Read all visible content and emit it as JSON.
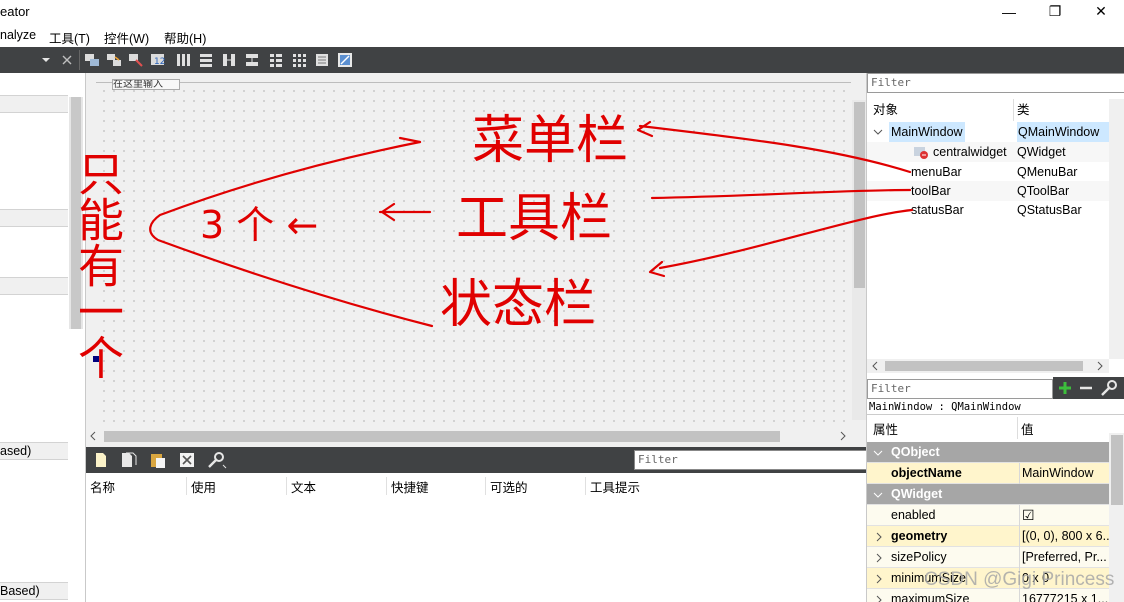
{
  "window": {
    "title_fragment": "eator",
    "controls": {
      "minimize": "—",
      "maximize": "❐",
      "close": "✕"
    }
  },
  "menubar": {
    "items": [
      "nalyze",
      "工具(T)",
      "控件(W)",
      "帮助(H)"
    ]
  },
  "left_dock": {
    "bottom_labels": [
      "ased)",
      "Based)"
    ]
  },
  "form_editor": {
    "tab_label": "在这里输入"
  },
  "action_editor": {
    "filter_placeholder": "Filter",
    "columns": [
      "名称",
      "使用",
      "文本",
      "快捷键",
      "可选的",
      "工具提示"
    ]
  },
  "object_inspector": {
    "filter_placeholder": "Filter",
    "headers": {
      "object": "对象",
      "class": "类"
    },
    "rows": [
      {
        "name": "MainWindow",
        "class": "QMainWindow"
      },
      {
        "name": "centralwidget",
        "class": "QWidget"
      },
      {
        "name": "menuBar",
        "class": "QMenuBar"
      },
      {
        "name": "toolBar",
        "class": "QToolBar"
      },
      {
        "name": "statusBar",
        "class": "QStatusBar"
      }
    ]
  },
  "property_editor": {
    "filter_placeholder": "Filter",
    "class_label": "MainWindow : QMainWindow",
    "headers": {
      "property": "属性",
      "value": "值"
    },
    "rows": [
      {
        "kind": "group",
        "name": "QObject",
        "value": ""
      },
      {
        "kind": "prop",
        "name": "objectName",
        "value": "MainWindow",
        "bold": true
      },
      {
        "kind": "group",
        "name": "QWidget",
        "value": ""
      },
      {
        "kind": "prop",
        "name": "enabled",
        "value": "☑",
        "bold": false
      },
      {
        "kind": "prop",
        "name": "geometry",
        "value": "[(0, 0), 800 x 6...",
        "bold": true
      },
      {
        "kind": "prop",
        "name": "sizePolicy",
        "value": "[Preferred, Pr...",
        "bold": false
      },
      {
        "kind": "prop",
        "name": "minimumSize",
        "value": "0 x 0",
        "bold": false
      },
      {
        "kind": "prop",
        "name": "maximumSize",
        "value": "16777215 x 1...",
        "bold": false
      }
    ]
  },
  "annotations": {
    "menubar_note": "菜单栏",
    "toolbar_note": "工具栏",
    "statusbar_note": "状态栏",
    "count_note": "3 个 ←",
    "side_note": "只能有一个"
  },
  "watermark": "CSDN @Gigi Princess",
  "colors": {
    "toolbar_bg": "#404244",
    "selection": "#cde8ff",
    "group_bg": "#a6a6a6",
    "annotation": "#e00000"
  }
}
